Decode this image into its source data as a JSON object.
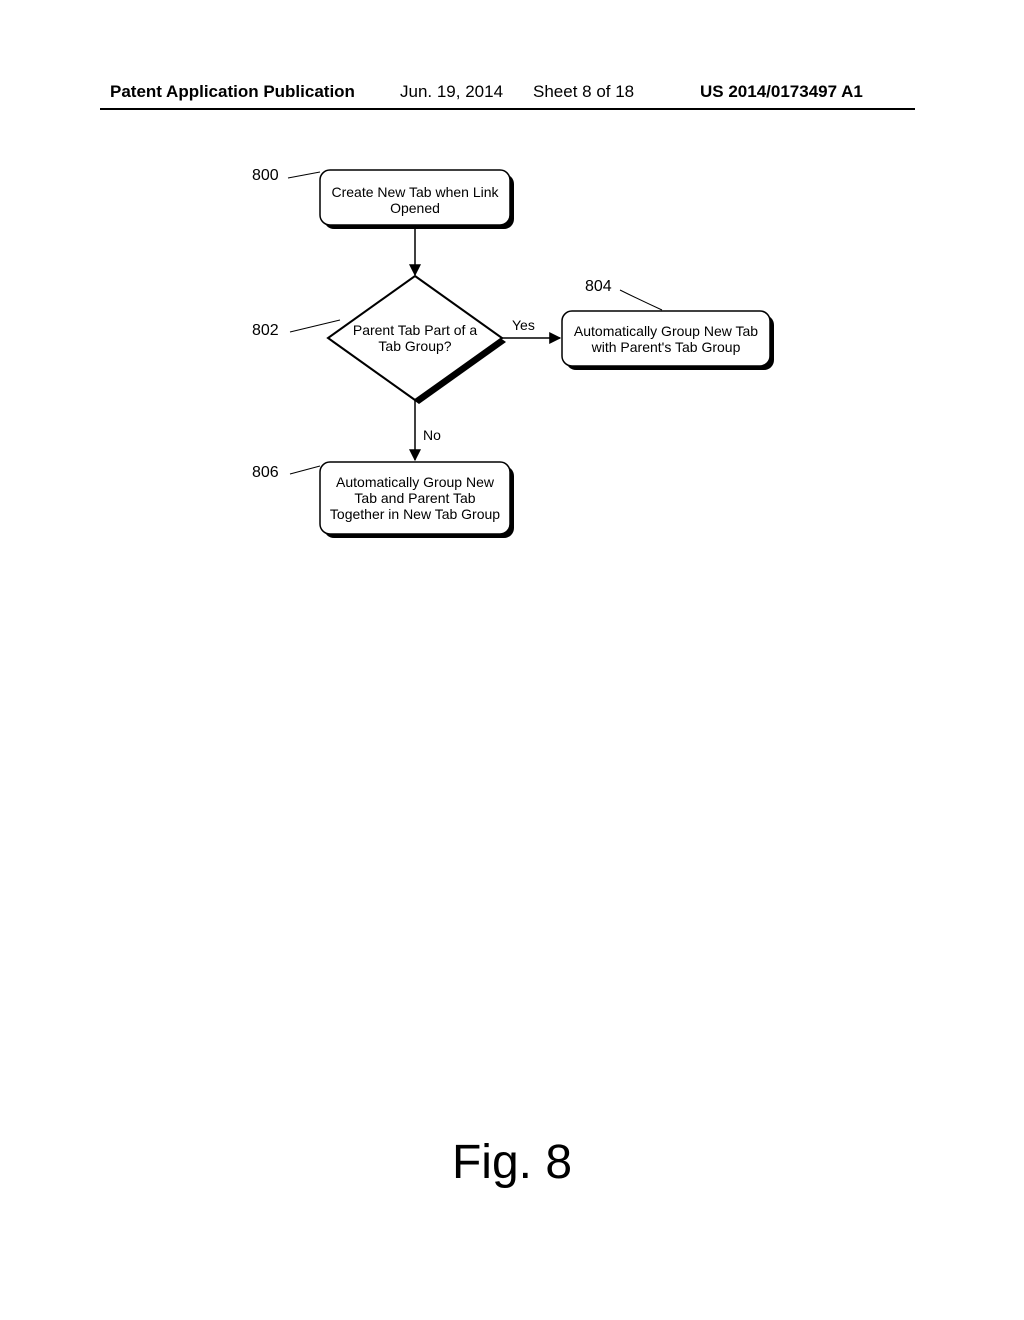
{
  "header": {
    "publication": "Patent Application Publication",
    "date": "Jun. 19, 2014",
    "sheet": "Sheet 8 of 18",
    "docnumber": "US 2014/0173497 A1"
  },
  "figure_label": "Fig. 8",
  "refs": {
    "r800": "800",
    "r802": "802",
    "r804": "804",
    "r806": "806"
  },
  "nodes": {
    "n800": "Create New Tab when Link Opened",
    "n802": "Parent Tab Part of a Tab Group?",
    "n804": "Automatically Group New Tab with Parent's Tab Group",
    "n806": "Automatically Group New Tab and Parent Tab Together in New Tab Group"
  },
  "edges": {
    "yes": "Yes",
    "no": "No"
  }
}
